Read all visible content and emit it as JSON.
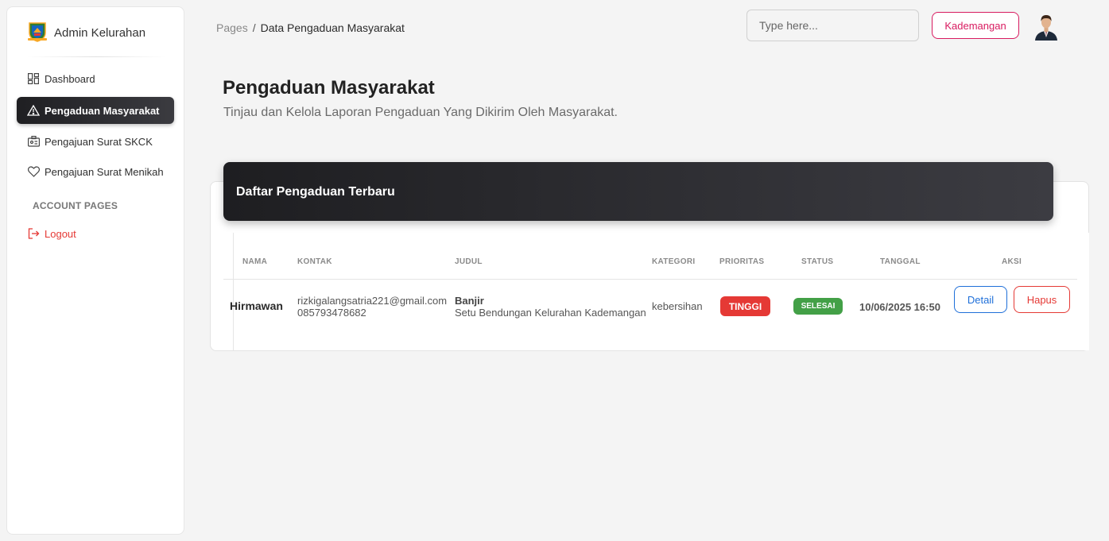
{
  "sidebar": {
    "brand": "Admin Kelurahan",
    "items": [
      {
        "label": "Dashboard",
        "icon": "dashboard-icon"
      },
      {
        "label": "Pengaduan Masyarakat",
        "icon": "warning-icon",
        "active": true
      },
      {
        "label": "Pengajuan Surat SKCK",
        "icon": "id-card-icon"
      },
      {
        "label": "Pengajuan Surat Menikah",
        "icon": "heart-icon"
      }
    ],
    "section_label": "ACCOUNT PAGES",
    "logout_label": "Logout"
  },
  "topbar": {
    "breadcrumb_root": "Pages",
    "breadcrumb_separator": "/",
    "breadcrumb_current": "Data Pengaduan Masyarakat",
    "search_placeholder": "Type here...",
    "location_button": "Kademangan"
  },
  "page": {
    "title": "Pengaduan Masyarakat",
    "subtitle": "Tinjau dan Kelola Laporan Pengaduan Yang Dikirim Oleh Masyarakat."
  },
  "card": {
    "title": "Daftar Pengaduan Terbaru",
    "columns": [
      "NAMA",
      "KONTAK",
      "JUDUL",
      "KATEGORI",
      "PRIORITAS",
      "STATUS",
      "TANGGAL",
      "AKSI"
    ],
    "rows": [
      {
        "nama": "Hirmawan",
        "email": "rizkigalangsatria221@gmail.com",
        "phone": "085793478682",
        "judul": "Banjir",
        "lokasi": "Setu Bendungan Kelurahan Kademangan",
        "kategori": "kebersihan",
        "prioritas": "TINGGI",
        "status": "SELESAI",
        "tanggal": "10/06/2025 16:50",
        "detail_label": "Detail",
        "hapus_label": "Hapus"
      }
    ]
  },
  "colors": {
    "accent": "#d81b60",
    "danger": "#e53935",
    "success": "#43a047",
    "primary": "#1e6fd9",
    "dark": "#2b2b2f"
  }
}
